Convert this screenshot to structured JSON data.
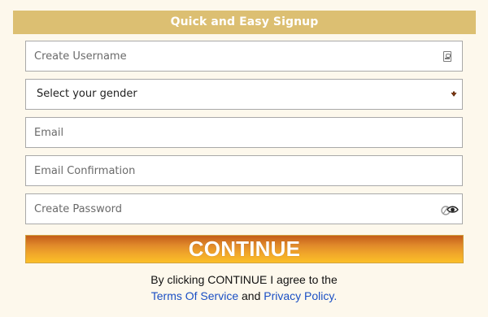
{
  "header": {
    "title": "Quick and Easy Signup"
  },
  "form": {
    "username": {
      "placeholder": "Create Username",
      "value": ""
    },
    "gender": {
      "selected": "Select your gender"
    },
    "email": {
      "placeholder": "Email",
      "value": ""
    },
    "email_confirm": {
      "placeholder": "Email Confirmation",
      "value": ""
    },
    "password": {
      "placeholder": "Create Password",
      "value": ""
    }
  },
  "continue_label": "CONTINUE",
  "terms": {
    "line1": "By clicking CONTINUE I agree to the",
    "tos_link": "Terms Of Service",
    "and": " and ",
    "privacy_link": "Privacy Policy."
  },
  "icons": {
    "username": "id-card-icon",
    "gender": "chevron-down-icon",
    "password": "eye-toggle-icon"
  },
  "colors": {
    "background": "#fdf8ec",
    "header": "#dcbf72",
    "link": "#1a4fc4",
    "button_top": "#c45c1a",
    "button_bottom": "#fbbf28"
  }
}
